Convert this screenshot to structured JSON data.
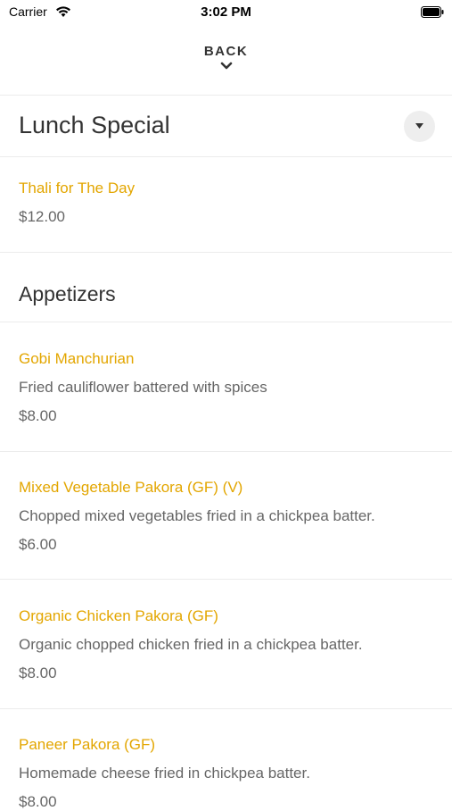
{
  "status_bar": {
    "carrier": "Carrier",
    "time": "3:02 PM"
  },
  "nav": {
    "back_label": "BACK"
  },
  "sections": [
    {
      "title": "Lunch Special",
      "items": [
        {
          "name": "Thali for The Day",
          "description": "",
          "price": "$12.00"
        }
      ]
    },
    {
      "title": "Appetizers",
      "items": [
        {
          "name": "Gobi Manchurian",
          "description": "Fried cauliflower battered with spices",
          "price": "$8.00"
        },
        {
          "name": "Mixed Vegetable Pakora (GF) (V)",
          "description": "Chopped mixed vegetables fried in a chickpea batter.",
          "price": "$6.00"
        },
        {
          "name": "Organic Chicken Pakora (GF)",
          "description": "Organic chopped chicken fried in a chickpea batter.",
          "price": "$8.00"
        },
        {
          "name": "Paneer Pakora (GF)",
          "description": "Homemade cheese fried in chickpea batter.",
          "price": "$8.00"
        }
      ]
    }
  ],
  "colors": {
    "item_name": "#e3a600",
    "body_text": "#666666",
    "heading": "#333333",
    "divider": "#ececec"
  }
}
